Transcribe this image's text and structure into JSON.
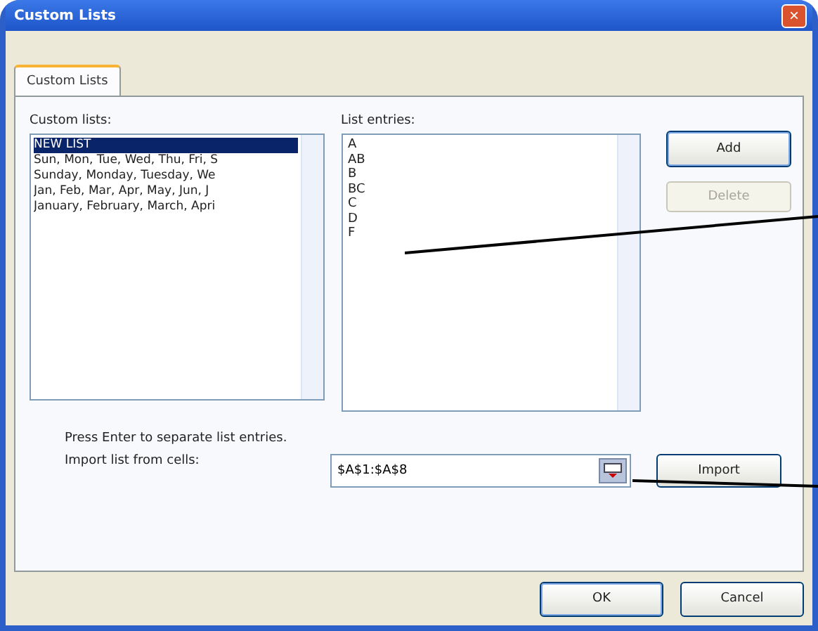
{
  "window": {
    "title": "Custom Lists",
    "close_button": "×"
  },
  "tabs": [
    {
      "label": "Custom Lists",
      "selected": true
    }
  ],
  "custom_lists": {
    "label": "Custom lists:",
    "items": [
      {
        "text": "NEW LIST",
        "selected": true
      },
      {
        "text": "Sun, Mon, Tue, Wed, Thu, Fri, S",
        "selected": false
      },
      {
        "text": "Sunday, Monday, Tuesday, We",
        "selected": false
      },
      {
        "text": "Jan, Feb, Mar, Apr, May, Jun, J",
        "selected": false
      },
      {
        "text": "January, February, March, Apri",
        "selected": false
      }
    ]
  },
  "list_entries": {
    "label": "List entries:",
    "lines": [
      "A",
      "AB",
      "B",
      "BC",
      "C",
      "D",
      "F"
    ]
  },
  "side_buttons": [
    {
      "label": "Add",
      "disabled": false
    },
    {
      "label": "Delete",
      "disabled": true
    }
  ],
  "hint": "Press Enter to separate list entries.",
  "import": {
    "label": "Import list from cells:",
    "value": "$A$1:$A$8",
    "button": "Import"
  },
  "footer_buttons": [
    "OK",
    "Cancel"
  ]
}
